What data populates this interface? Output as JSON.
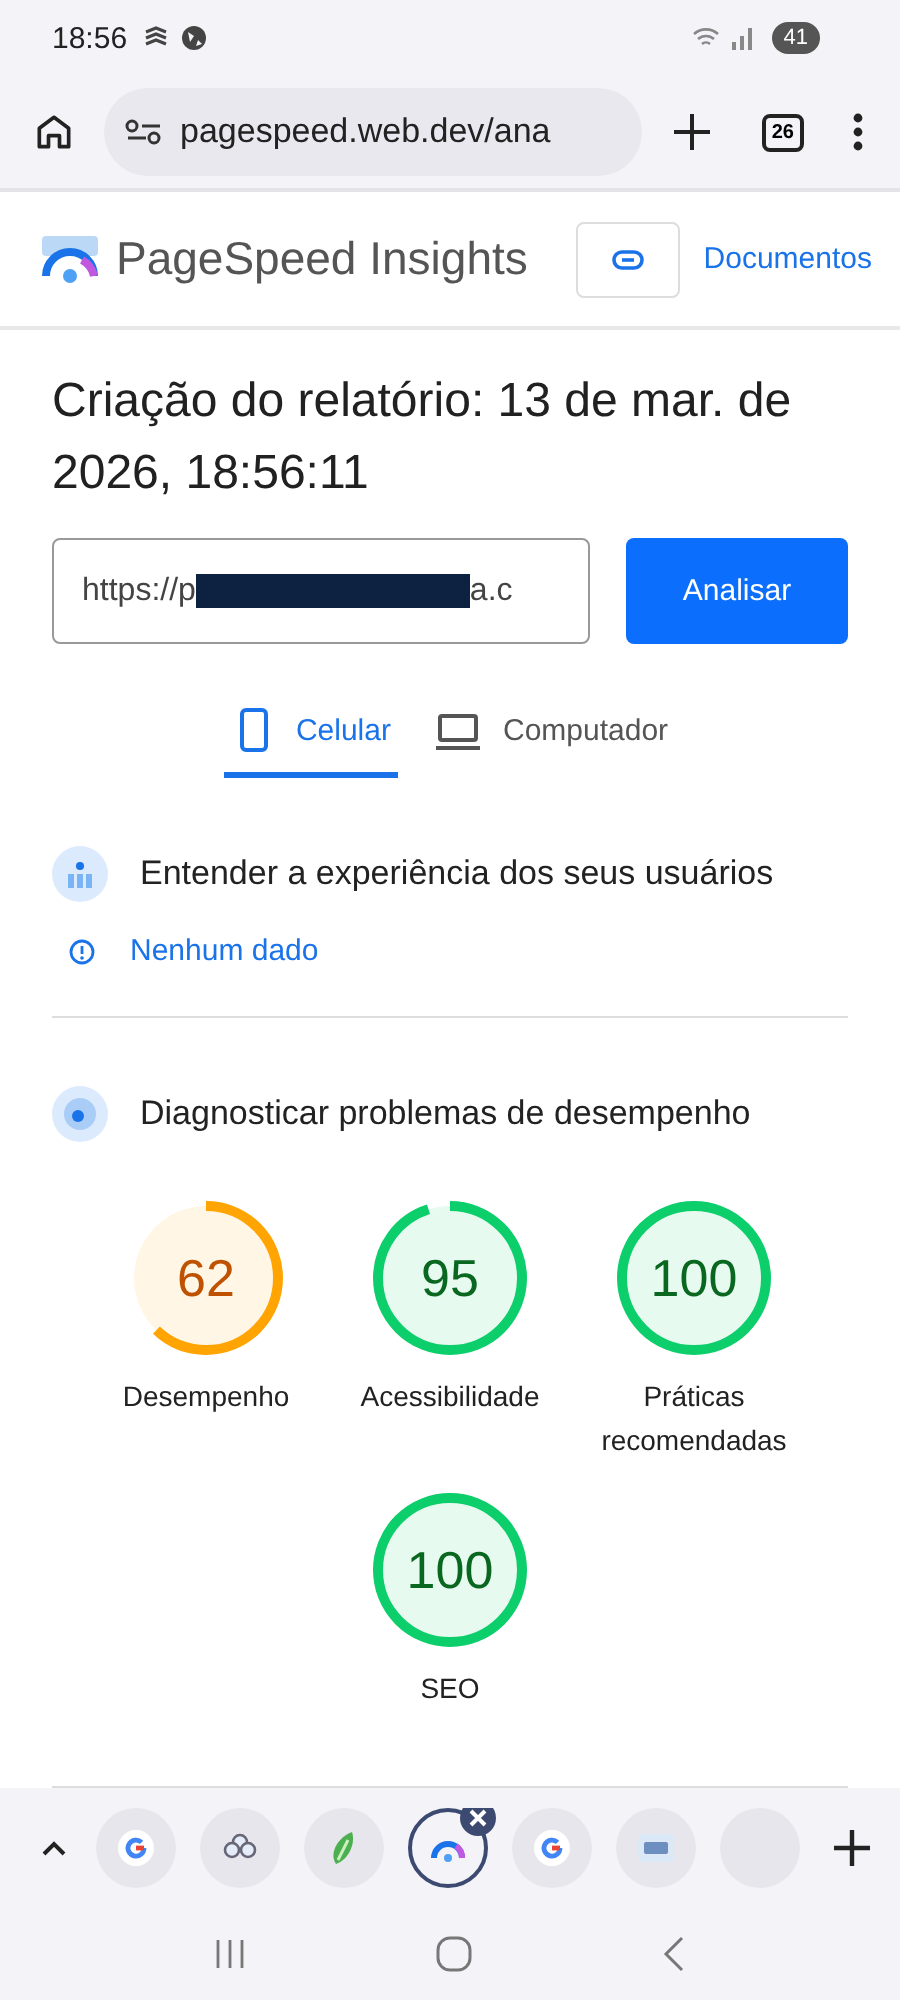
{
  "status_bar": {
    "time": "18:56",
    "battery": "41"
  },
  "browser": {
    "url": "pagespeed.web.dev/ana",
    "tab_count": "26"
  },
  "header": {
    "title": "PageSpeed Insights",
    "link": "Documentos"
  },
  "report": {
    "title": "Criação do relatório: 13 de mar. de 2026, 18:56:11"
  },
  "url_field": {
    "value_before": "https://p",
    "redacted": true,
    "value_after": "a.c"
  },
  "analyze_button": "Analisar",
  "device_tabs": [
    {
      "kind": "phone",
      "label": "Celular",
      "selected": true
    },
    {
      "kind": "laptop",
      "label": "Computador",
      "selected": false
    }
  ],
  "field_section": {
    "title": "Entender a experiência dos seus usuários",
    "notice": "Nenhum dado"
  },
  "lab_section": {
    "title": "Diagnosticar problemas de desempenho"
  },
  "scores": [
    {
      "value": "62",
      "level": 0.62,
      "color": "#ffa400",
      "label": "Desempenho"
    },
    {
      "value": "95",
      "level": 0.95,
      "color": "#0cce6b",
      "label": "Acessibilidade"
    },
    {
      "value": "100",
      "level": 1,
      "color": "#0cce6b",
      "label": "Práticas recomendadas"
    },
    {
      "value": "100",
      "level": 1,
      "color": "#0cce6b",
      "label": "SEO"
    }
  ],
  "tab_strip": [
    {
      "kind": "google",
      "selected": false
    },
    {
      "kind": "flower",
      "selected": false
    },
    {
      "kind": "leaf",
      "selected": false
    },
    {
      "kind": "pagespeed",
      "selected": true
    },
    {
      "kind": "google",
      "selected": false
    },
    {
      "kind": "translate",
      "selected": false
    },
    {
      "kind": "partial",
      "selected": false
    }
  ]
}
